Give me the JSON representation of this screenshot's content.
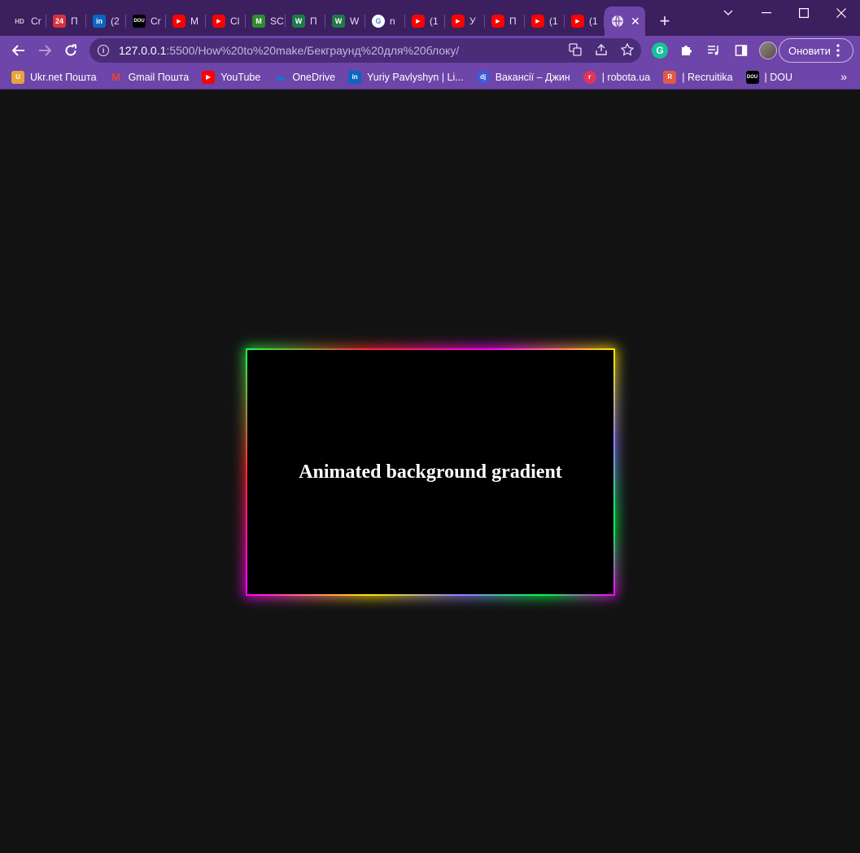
{
  "tabs": [
    {
      "icon": "hd-icon",
      "text": "Cr",
      "color": "#3b1f5f"
    },
    {
      "icon": "news24-icon",
      "text": "П",
      "color": "#d9303a"
    },
    {
      "icon": "linkedin-icon",
      "text": "(2",
      "color": "#0a66c2"
    },
    {
      "icon": "dou-icon",
      "text": "Cr",
      "color": "#000000"
    },
    {
      "icon": "youtube-icon",
      "text": "M",
      "color": "#ff0000"
    },
    {
      "icon": "youtube-icon",
      "text": "Cl",
      "color": "#ff0000"
    },
    {
      "icon": "m-icon",
      "text": "SC",
      "color": "#2e8b2e"
    },
    {
      "icon": "w-icon",
      "text": "П",
      "color": "#1f7a4a"
    },
    {
      "icon": "w-icon",
      "text": "W",
      "color": "#1f7a4a"
    },
    {
      "icon": "google-icon",
      "text": "n",
      "color": "#ffffff"
    },
    {
      "icon": "youtube-icon",
      "text": "(1",
      "color": "#ff0000"
    },
    {
      "icon": "youtube-icon",
      "text": "У",
      "color": "#ff0000"
    },
    {
      "icon": "youtube-icon",
      "text": "П",
      "color": "#ff0000"
    },
    {
      "icon": "youtube-icon",
      "text": "(1",
      "color": "#ff0000"
    },
    {
      "icon": "youtube-icon",
      "text": "(1",
      "color": "#ff0000"
    }
  ],
  "active_tab": {
    "icon": "globe-icon"
  },
  "toolbar": {
    "url_host": "127.0.0.1",
    "url_path": ":5500/How%20to%20make/Бекграунд%20для%20блоку/",
    "update_label": "Оновити"
  },
  "bookmarks": [
    {
      "label": "Ukr.net Пошта",
      "icon": "ukrnet-icon",
      "color": "#e8a33d"
    },
    {
      "label": "Gmail Пошта",
      "icon": "gmail-icon",
      "color": "#ea4335"
    },
    {
      "label": "YouTube",
      "icon": "youtube-icon",
      "color": "#ff0000"
    },
    {
      "label": "OneDrive",
      "icon": "onedrive-icon",
      "color": "#0f78d4"
    },
    {
      "label": "Yuriy Pavlyshyn | Li...",
      "icon": "linkedin-icon",
      "color": "#0a66c2"
    },
    {
      "label": "Вакансії – Джин",
      "icon": "djinni-icon",
      "color": "#3b5bdb"
    },
    {
      "label": "| robota.ua",
      "icon": "robota-icon",
      "color": "#e0345a"
    },
    {
      "label": "| Recruitika",
      "icon": "recruitika-icon",
      "color": "#e05a4a"
    },
    {
      "label": "| DOU",
      "icon": "dou-icon",
      "color": "#000000"
    }
  ],
  "page": {
    "heading": "Animated background gradient"
  }
}
